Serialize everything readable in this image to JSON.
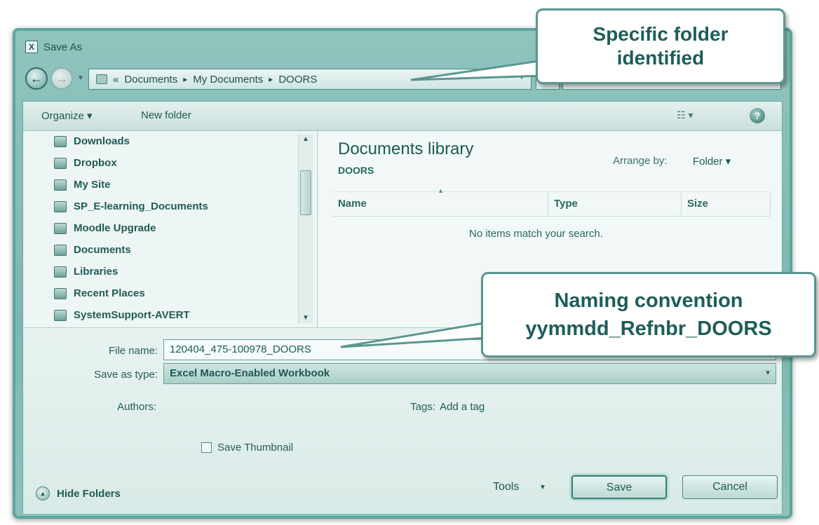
{
  "window": {
    "title": "Save As",
    "app_icon": "excel-icon"
  },
  "address": {
    "segments": [
      "Documents",
      "My Documents",
      "DOORS"
    ],
    "overflow": "«",
    "separator": "▸"
  },
  "toolbar": {
    "organize": "Organize ▾",
    "new_folder": "New folder",
    "view_icon": "view-options-icon",
    "help": "?"
  },
  "nav": {
    "items": [
      {
        "label": "Downloads",
        "icon": "downloads-folder-icon"
      },
      {
        "label": "Dropbox",
        "icon": "folder-icon"
      },
      {
        "label": "My Site",
        "icon": "mysite-icon"
      },
      {
        "label": "SP_E-learning_Documents",
        "icon": "folder-icon"
      },
      {
        "label": "Moodle Upgrade",
        "icon": "folder-icon"
      },
      {
        "label": "Documents",
        "icon": "document-icon"
      },
      {
        "label": "Libraries",
        "icon": "libraries-icon"
      },
      {
        "label": "Recent Places",
        "icon": "recent-places-icon"
      },
      {
        "label": "SystemSupport-AVERT",
        "icon": "folder-icon"
      }
    ]
  },
  "library": {
    "title": "Documents library",
    "subtitle": "DOORS",
    "arrange_label": "Arrange by:",
    "arrange_value": "Folder ▾",
    "columns": [
      "Name",
      "Type",
      "Size"
    ],
    "empty_message": "No items match your search."
  },
  "form": {
    "file_name_label": "File name:",
    "file_name_value": "120404_475-100978_DOORS",
    "save_type_label": "Save as type:",
    "save_type_value": "Excel Macro-Enabled Workbook",
    "authors_label": "Authors:",
    "tags_label": "Tags:",
    "tags_value": "Add a tag",
    "thumbnail_label": "Save Thumbnail"
  },
  "footer": {
    "hide_folders": "Hide Folders",
    "tools": "Tools",
    "save": "Save",
    "cancel": "Cancel"
  },
  "callouts": {
    "folder_line1": "Specific folder",
    "folder_line2": "identified",
    "naming_line1": "Naming convention",
    "naming_line2": "yymmdd_Refnbr_DOORS"
  },
  "colors": {
    "accent": "#1d5a55",
    "window": "#7bb8b1",
    "callout_border": "#5a9690"
  }
}
